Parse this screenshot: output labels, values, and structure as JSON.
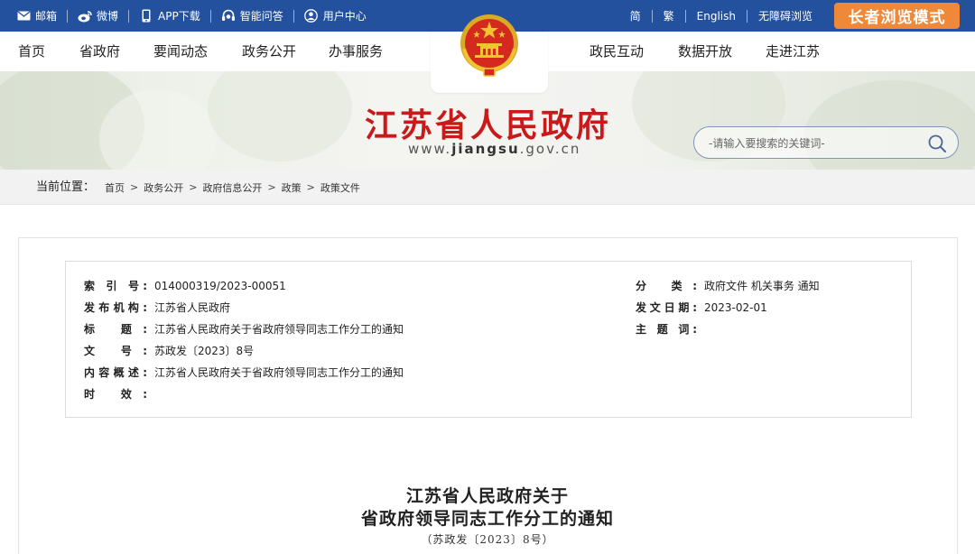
{
  "topbar": {
    "links": [
      {
        "label": "邮箱",
        "icon": "mail-icon"
      },
      {
        "label": "微博",
        "icon": "weibo-icon"
      },
      {
        "label": "APP下载",
        "icon": "phone-icon"
      },
      {
        "label": "智能问答",
        "icon": "headset-icon"
      },
      {
        "label": "用户中心",
        "icon": "user-icon"
      }
    ],
    "lang_links": [
      "简",
      "繁",
      "English",
      "无障碍浏览"
    ],
    "elder_mode_label": "长者浏览模式",
    "bg_color": "#23519e",
    "elder_color": "#f0883a"
  },
  "nav": {
    "left_items": [
      "首页",
      "省政府",
      "要闻动态",
      "政务公开",
      "办事服务"
    ],
    "right_items": [
      "政民互动",
      "数据开放",
      "走进江苏"
    ]
  },
  "banner": {
    "title": "江苏省人民政府",
    "url_prefix": "www.",
    "url_bold": "jiangsu",
    "url_suffix": ".gov.cn",
    "title_color": "#c81a1a"
  },
  "search": {
    "placeholder": "-请输入要搜索的关键词-"
  },
  "breadcrumb": {
    "label": "当前位置：",
    "items": [
      "首页",
      "政务公开",
      "政府信息公开",
      "政策",
      "政策文件"
    ]
  },
  "meta": {
    "left": [
      {
        "key": "索 引 号:",
        "value": "014000319/2023-00051"
      },
      {
        "key": "发布机构:",
        "value": "江苏省人民政府"
      },
      {
        "key": "标 题:",
        "value": "江苏省人民政府关于省政府领导同志工作分工的通知"
      },
      {
        "key": "文 号:",
        "value": "苏政发〔2023〕8号"
      },
      {
        "key": "内容概述:",
        "value": "江苏省人民政府关于省政府领导同志工作分工的通知"
      },
      {
        "key": "时 效:",
        "value": ""
      }
    ],
    "right": [
      {
        "key": "分 类:",
        "value": "政府文件 机关事务 通知"
      },
      {
        "key": "发文日期:",
        "value": "2023-02-01"
      },
      {
        "key": "主 题 词:",
        "value": ""
      }
    ]
  },
  "document": {
    "title_line1": "江苏省人民政府关于",
    "title_line2": "省政府领导同志工作分工的通知",
    "doc_number": "（苏政发〔2023〕8号）"
  }
}
